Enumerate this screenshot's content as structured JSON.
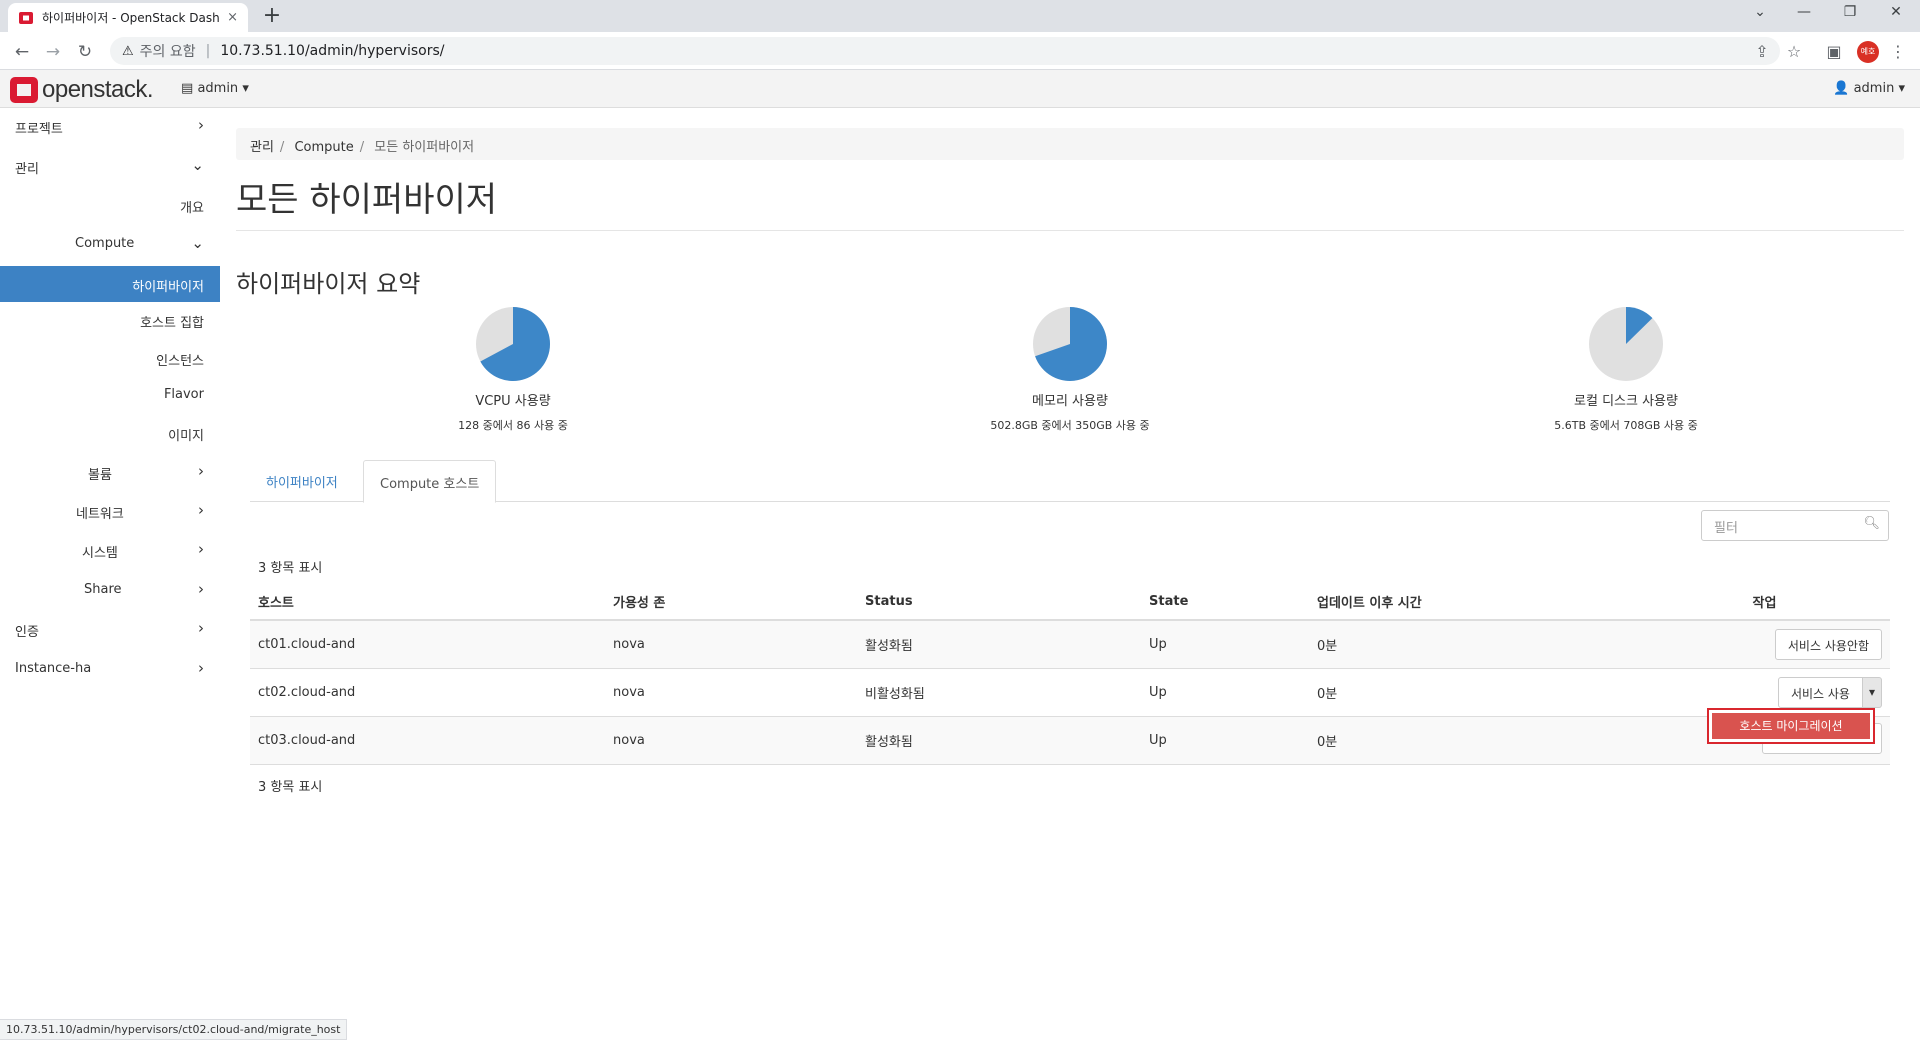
{
  "browser": {
    "tab_title": "하이퍼바이저 - OpenStack Dash",
    "tab_close": "×",
    "new_tab": "+",
    "security_label": "주의 요함",
    "url": "10.73.51.10/admin/hypervisors/",
    "profile_initials": "예호",
    "window_controls": [
      "⌄",
      "—",
      "❐",
      "✕"
    ]
  },
  "header": {
    "logo_text": "openstack.",
    "project": "admin",
    "user": "admin"
  },
  "sidebar": {
    "items": [
      {
        "label": "프로젝트",
        "chevron": "›"
      },
      {
        "label": "관리",
        "chevron": "⌄"
      },
      {
        "label": "개요"
      },
      {
        "label": "Compute",
        "chevron": "⌄"
      },
      {
        "label": "하이퍼바이저"
      },
      {
        "label": "호스트 집합"
      },
      {
        "label": "인스턴스"
      },
      {
        "label": "Flavor"
      },
      {
        "label": "이미지"
      },
      {
        "label": "볼륨",
        "chevron": "›"
      },
      {
        "label": "네트워크",
        "chevron": "›"
      },
      {
        "label": "시스템",
        "chevron": "›"
      },
      {
        "label": "Share",
        "chevron": "›"
      },
      {
        "label": "인증",
        "chevron": "›"
      },
      {
        "label": "Instance-ha",
        "chevron": "›"
      }
    ]
  },
  "breadcrumb": [
    "관리",
    "Compute",
    "모든 하이퍼바이저"
  ],
  "page_title": "모든 하이퍼바이저",
  "summary": {
    "title": "하이퍼바이저 요약",
    "charts": [
      {
        "label": "VCPU 사용량",
        "sub": "128 중에서 86 사용 중",
        "used": 86,
        "total": 128
      },
      {
        "label": "메모리 사용량",
        "sub": "502.8GB 중에서 350GB 사용 중",
        "used": 350,
        "total": 502.8
      },
      {
        "label": "로컬 디스크 사용량",
        "sub": "5.6TB 중에서 708GB 사용 중",
        "used": 0.708,
        "total": 5.6
      }
    ],
    "colors": {
      "used": "#3d87c8",
      "free": "#e0e0e0"
    }
  },
  "tabs": [
    "하이퍼바이저",
    "Compute 호스트"
  ],
  "filter_placeholder": "필터",
  "count_text": "3 항목 표시",
  "table": {
    "headers": [
      "호스트",
      "가용성 존",
      "Status",
      "State",
      "업데이트 이후 시간",
      "작업"
    ],
    "rows": [
      {
        "host": "ct01.cloud-and",
        "zone": "nova",
        "status": "활성화됨",
        "state": "Up",
        "updated": "0분",
        "action": "서비스 사용안함"
      },
      {
        "host": "ct02.cloud-and",
        "zone": "nova",
        "status": "비활성화됨",
        "state": "Up",
        "updated": "0분",
        "action": "서비스 사용"
      },
      {
        "host": "ct03.cloud-and",
        "zone": "nova",
        "status": "활성화됨",
        "state": "Up",
        "updated": "0분",
        "action": ""
      }
    ]
  },
  "dropdown_item": "호스트 마이그레이션",
  "status_url": "10.73.51.10/admin/hypervisors/ct02.cloud-and/migrate_host"
}
